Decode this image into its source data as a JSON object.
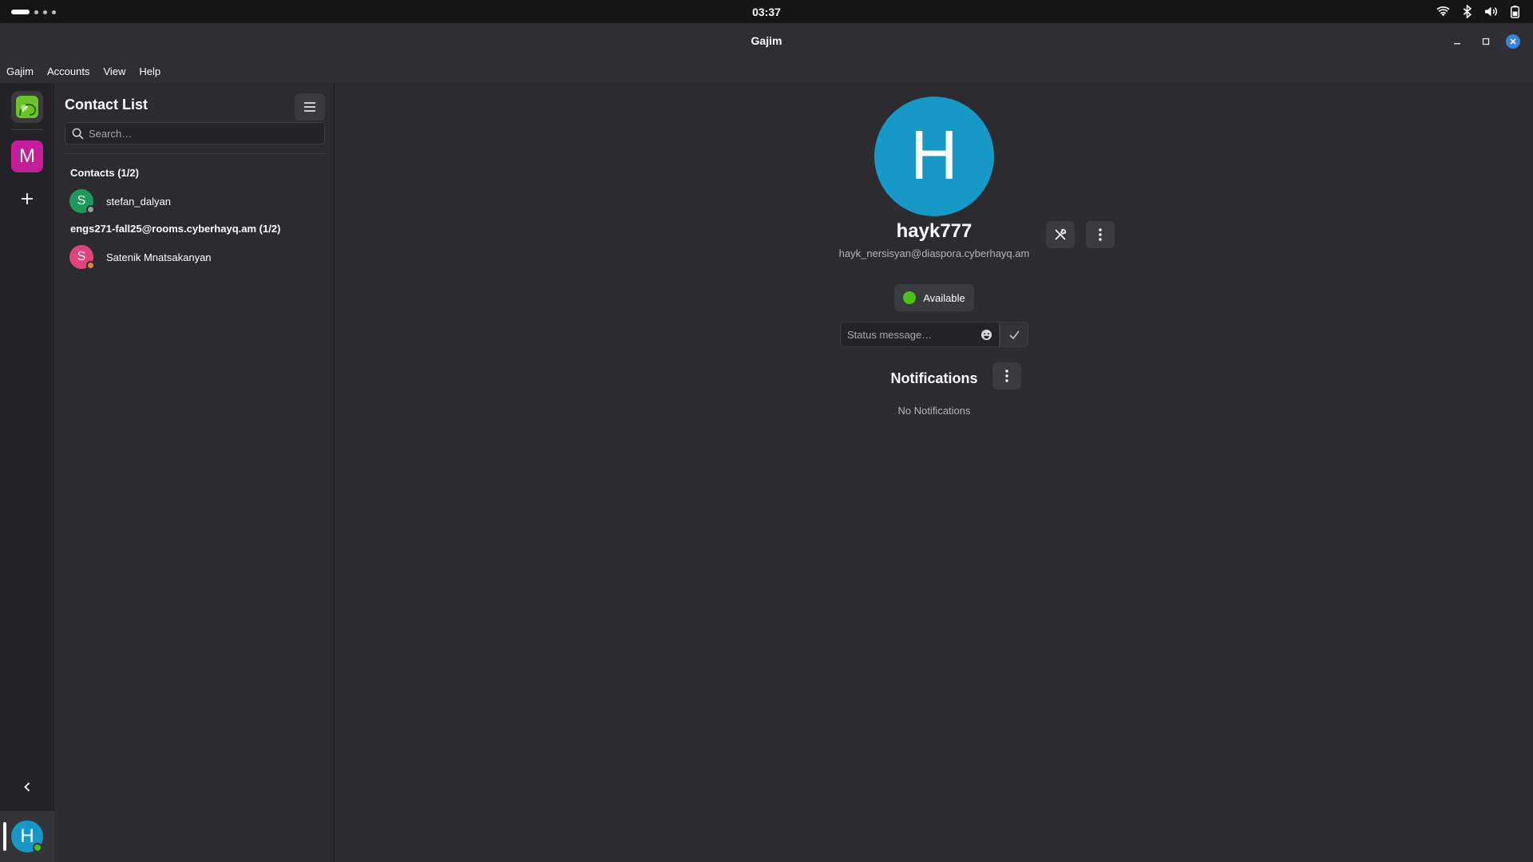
{
  "system_bar": {
    "clock": "03:37",
    "tray_icons": [
      "wifi-icon",
      "bluetooth-icon",
      "volume-icon",
      "battery-icon"
    ]
  },
  "window": {
    "title": "Gajim"
  },
  "menubar": {
    "items": [
      "Gajim",
      "Accounts",
      "View",
      "Help"
    ]
  },
  "rail": {
    "account_initial": "M",
    "account_color": "#c51e9a",
    "add_symbol": "+",
    "self_initial": "H",
    "self_color": "#1898c6",
    "self_status_color": "#4cc21c"
  },
  "contact_list": {
    "heading": "Contact List",
    "search_placeholder": "Search…",
    "groups": [
      {
        "label": "Contacts (1/2)",
        "contacts": [
          {
            "initial": "S",
            "name": "stefan_dalyan",
            "avatar_color": "#1e9a5a",
            "status_color": "#9a9a9a"
          }
        ]
      },
      {
        "label": "engs271-fall25@rooms.cyberhayq.am (1/2)",
        "contacts": [
          {
            "initial": "S",
            "name": "Satenik Mnatsakanyan",
            "avatar_color": "#e0427a",
            "status_color": "#f07f2a"
          }
        ]
      }
    ]
  },
  "profile": {
    "avatar_initial": "H",
    "avatar_color": "#1898c6",
    "nickname": "hayk777",
    "jid": "hayk_nersisyan@diaspora.cyberhayq.am",
    "status_label": "Available",
    "status_color": "#4cc21c",
    "status_message_placeholder": "Status message…",
    "notifications_title": "Notifications",
    "no_notifications": "No Notifications"
  }
}
